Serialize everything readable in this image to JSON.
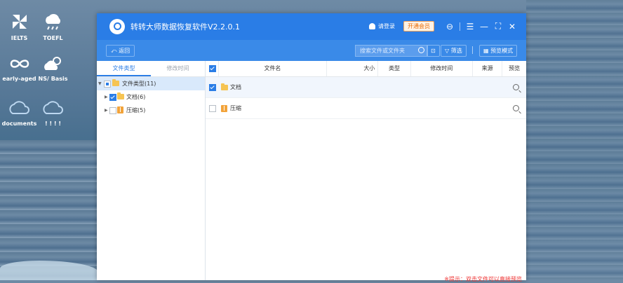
{
  "desktop": {
    "items": [
      {
        "label": "IELTS",
        "icon": "pinwheel-icon"
      },
      {
        "label": "TOEFL",
        "icon": "cloud-rain-icon"
      },
      {
        "label": "early-aged",
        "icon": "infinity-icon"
      },
      {
        "label": "NS/ Basis",
        "icon": "cloud-sun-icon"
      },
      {
        "label": "documents",
        "icon": "cloud-icon"
      },
      {
        "label": "! ! ! !",
        "icon": "cloud-icon"
      }
    ]
  },
  "window": {
    "title": "转转大师数据恢复软件V2.2.0.1",
    "login_label": "请登录",
    "vip_label": "开通会员",
    "controls": {
      "feedback": "⊖",
      "menu": "☰",
      "minimize": "—",
      "maximize": "⛶",
      "close": "✕"
    }
  },
  "toolbar": {
    "back_label": "⤺ 返回",
    "search_placeholder": "搜索文件或文件夹",
    "filter_label": "筛选",
    "preview_mode_label": "预览模式"
  },
  "left_panel": {
    "tabs": [
      "文件类型",
      "修改时间"
    ],
    "tree": {
      "root": "文件类型(11)",
      "children": [
        {
          "label": "文档(6)",
          "checked": true
        },
        {
          "label": "压缩(5)",
          "checked": false
        }
      ]
    }
  },
  "table": {
    "columns": [
      "文件名",
      "大小",
      "类型",
      "修改时间",
      "来源",
      "预览"
    ],
    "rows": [
      {
        "name": "文档",
        "checked": true
      },
      {
        "name": "压缩",
        "checked": false
      }
    ]
  },
  "hint": "※提示：双击文件可以直接预览",
  "colors": {
    "accent": "#2a7de6",
    "vip": "#e86a00"
  }
}
